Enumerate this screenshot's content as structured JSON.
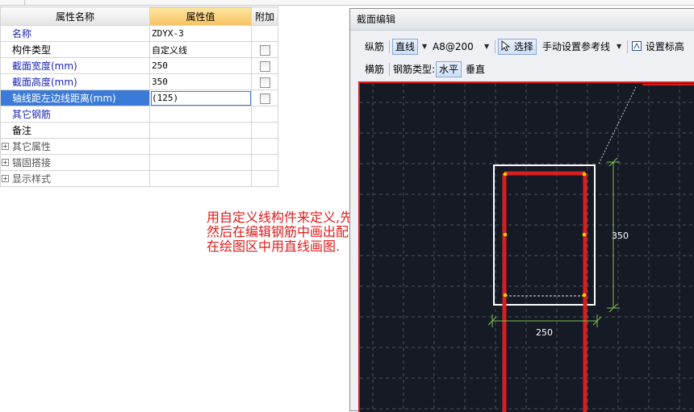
{
  "property_grid": {
    "headers": {
      "name": "属性名称",
      "value": "属性值",
      "add": "附加"
    },
    "rows": [
      {
        "name": "名称",
        "value": "ZDYX-3",
        "checkbox": false
      },
      {
        "name": "构件类型",
        "value": "自定义线",
        "checkbox": true
      },
      {
        "name": "截面宽度(mm)",
        "value": "250",
        "checkbox": true
      },
      {
        "name": "截面高度(mm)",
        "value": "350",
        "checkbox": true
      },
      {
        "name": "轴线距左边线距离(mm)",
        "value": "(125)",
        "checkbox": true
      },
      {
        "name": "其它钢筋",
        "value": "",
        "checkbox": false
      },
      {
        "name": "备注",
        "value": "",
        "checkbox": false
      },
      {
        "name": "其它属性",
        "value": "",
        "checkbox": false
      },
      {
        "name": "锚固搭接",
        "value": "",
        "checkbox": false
      },
      {
        "name": "显示样式",
        "value": "",
        "checkbox": false
      }
    ]
  },
  "annotation": {
    "line1": "用自定义线构件来定义,先定义出截面,",
    "line2": "然后在编辑钢筋中画出配筋,定义好后",
    "line3": "在绘图区中用直线画图."
  },
  "editor": {
    "title": "截面编辑",
    "toolbar1": {
      "longitudinal": "纵筋",
      "line_tool": "直线",
      "rebar_spec": "A8@200",
      "select": "选择",
      "manual_ref": "手动设置参考线",
      "set_elevation": "设置标高"
    },
    "toolbar2": {
      "transverse": "横筋",
      "rebar_type_label": "钢筋类型:",
      "horizontal": "水平",
      "vertical": "垂直"
    },
    "canvas": {
      "dim_height": "350",
      "dim_width": "250"
    }
  },
  "colors": {
    "accent_red": "#e11b1b",
    "canvas_bg": "#161a25",
    "section_outline": "#ffffff",
    "rebar_red": "#d42020",
    "dimension_green": "#7cc04a"
  }
}
